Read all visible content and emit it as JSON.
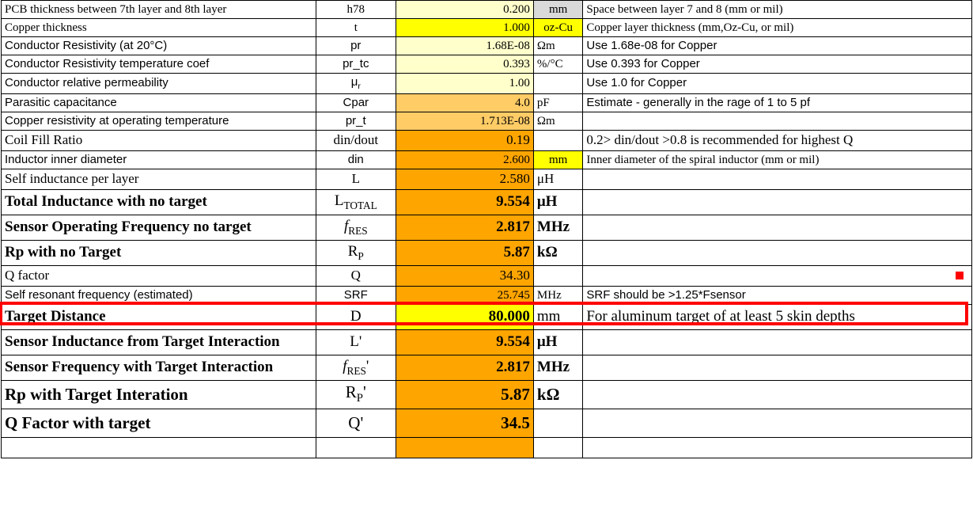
{
  "rows": [
    {
      "h": "h-s",
      "param": "PCB thickness between 7th layer and 8th layer",
      "sym_html": "h78",
      "val": "0.200",
      "val_bg": "bg-palegold",
      "unit": "mm",
      "unit_bg": "bg-greyhdr",
      "unit_align": "unit-c",
      "note": "Space between layer 7 and 8  (mm or mil)"
    },
    {
      "h": "h-s",
      "param": "Copper thickness",
      "sym_html": "t",
      "val": "1.000",
      "val_bg": "bg-yellow",
      "unit": "oz-Cu",
      "unit_bg": "bg-yellow",
      "unit_align": "unit-c",
      "note": "Copper layer thickness  (mm,Oz-Cu, or mil)"
    },
    {
      "h": "h-s",
      "param": "Conductor Resistivity (at 20°C)",
      "param_cls": "ff-sans",
      "sym_html": "pr",
      "sym_cls": "ff-sans",
      "val": "1.68E-08",
      "val_bg": "bg-palegold",
      "unit": "Ωm",
      "note": "Use 1.68e-08 for Copper",
      "note_cls": "ff-sans"
    },
    {
      "h": "h-s",
      "param": "Conductor Resistivity temperature coef",
      "param_cls": "ff-sans",
      "sym_html": "pr_tc",
      "sym_cls": "ff-sans",
      "val": "0.393",
      "val_bg": "bg-palegold",
      "unit": "%/°C",
      "note": "Use 0.393 for Copper",
      "note_cls": "ff-sans"
    },
    {
      "h": "h-s",
      "param": "Conductor relative permeability",
      "param_cls": "ff-sans",
      "sym_html": "μ<sub>r</sub>",
      "sym_cls": "ff-sans",
      "val": "1.00",
      "val_bg": "bg-palegold",
      "unit": "",
      "note": "Use 1.0 for Copper",
      "note_cls": "ff-sans"
    },
    {
      "h": "h-s",
      "param": "Parasitic capacitance",
      "param_cls": "ff-sans",
      "sym_html": "Cpar",
      "sym_cls": "ff-sans",
      "val": "4.0",
      "val_bg": "bg-lightamber",
      "unit": "pF",
      "note": "Estimate - generally in the rage of 1 to 5 pf",
      "note_cls": "ff-sans"
    },
    {
      "h": "h-s",
      "param": "Copper resistivity at operating temperature",
      "param_cls": "ff-sans",
      "sym_html": "pr_t",
      "sym_cls": "ff-sans",
      "val": "1.713E-08",
      "val_bg": "bg-lightamber",
      "unit": "Ωm",
      "note": ""
    },
    {
      "h": "h-m",
      "param": "Coil Fill Ratio",
      "sym_html": "din/dout",
      "val": "0.19",
      "val_bg": "bg-amber",
      "unit": "",
      "note": "0.2> din/dout >0.8 is recommended for highest Q"
    },
    {
      "h": "h-s",
      "param": "Inductor inner diameter",
      "param_cls": "ff-sans",
      "sym_html": "din",
      "sym_cls": "ff-sans",
      "val": "2.600",
      "val_bg": "bg-amber",
      "unit": "mm",
      "unit_bg": "bg-yellow",
      "unit_align": "unit-c",
      "note": "Inner diameter of the spiral inductor (mm or mil)"
    },
    {
      "h": "h-m",
      "param": "Self inductance per layer",
      "sym_html": "L",
      "val": "2.580",
      "val_bg": "bg-amber",
      "unit": "μH",
      "note": ""
    },
    {
      "h": "h-l",
      "param": "Total Inductance with no target",
      "param_cls": "fw-bold",
      "sym_html": "L<sub>TOTAL</sub>",
      "val": "9.554",
      "val_bg": "bg-amber",
      "val_cls": "fw-bold",
      "unit": "μH",
      "unit_cls": "fw-bold",
      "note": ""
    },
    {
      "h": "h-l",
      "param": "Sensor Operating Frequency no target",
      "param_cls": "fw-bold",
      "sym_html": "<span class='ital'>f</span><sub>RES</sub>",
      "val": "2.817",
      "val_bg": "bg-amber",
      "val_cls": "fw-bold",
      "unit": "MHz",
      "unit_cls": "fw-bold",
      "note": ""
    },
    {
      "h": "h-l",
      "param": "Rp with no Target",
      "param_cls": "fw-bold",
      "sym_html": "R<sub>P</sub>",
      "val": "5.87",
      "val_bg": "bg-amber",
      "val_cls": "fw-bold",
      "unit": "kΩ",
      "unit_cls": "fw-bold",
      "note": ""
    },
    {
      "h": "h-m",
      "param": "Q factor",
      "sym_html": "Q",
      "val": "34.30",
      "val_bg": "bg-amber",
      "unit": "",
      "note": ""
    },
    {
      "h": "h-s",
      "param": "Self resonant frequency (estimated)",
      "param_cls": "ff-sans",
      "sym_html": "SRF",
      "sym_cls": "ff-sans",
      "val": "25.745",
      "val_bg": "bg-amber",
      "unit": "MHz",
      "note": "SRF should be >1.25*Fsensor",
      "note_cls": "ff-sans"
    },
    {
      "h": "h-l",
      "param": "Target Distance",
      "param_cls": "fw-bold",
      "sym_html": "D",
      "val": "80.000",
      "val_bg": "bg-yellow",
      "val_cls": "fw-bold",
      "unit": "mm",
      "note": "For aluminum target of at least 5 skin depths",
      "highlight": true
    },
    {
      "h": "h-l",
      "param": "Sensor Inductance from Target Interaction",
      "param_cls": "fw-bold",
      "sym_html": "L'",
      "val": "9.554",
      "val_bg": "bg-amber",
      "val_cls": "fw-bold",
      "unit": "μH",
      "unit_cls": "fw-bold",
      "note": ""
    },
    {
      "h": "h-l",
      "param": "Sensor Frequency with Target Interaction",
      "param_cls": "fw-bold",
      "sym_html": "<span class='ital'>f</span><sub>RES</sub>'",
      "val": "2.817",
      "val_bg": "bg-amber",
      "val_cls": "fw-bold",
      "unit": "MHz",
      "unit_cls": "fw-bold",
      "note": ""
    },
    {
      "h": "h-xl",
      "param": "Rp with Target Interation",
      "param_cls": "fw-bold",
      "sym_html": "R<sub>P</sub>'",
      "val": "5.87",
      "val_bg": "bg-amber",
      "val_cls": "fw-bold",
      "unit": "kΩ",
      "unit_cls": "fw-bold",
      "note": ""
    },
    {
      "h": "h-xl",
      "param": "Q Factor with target",
      "param_cls": "fw-bold",
      "sym_html": "Q'",
      "val": "34.5",
      "val_bg": "bg-amber",
      "val_cls": "fw-bold",
      "unit": "",
      "note": ""
    },
    {
      "h": "h-b",
      "param": "",
      "sym_html": "",
      "val": "",
      "val_bg": "bg-amber",
      "unit": "",
      "note": ""
    }
  ],
  "annotations": {
    "red_dot_row_index": 13
  }
}
